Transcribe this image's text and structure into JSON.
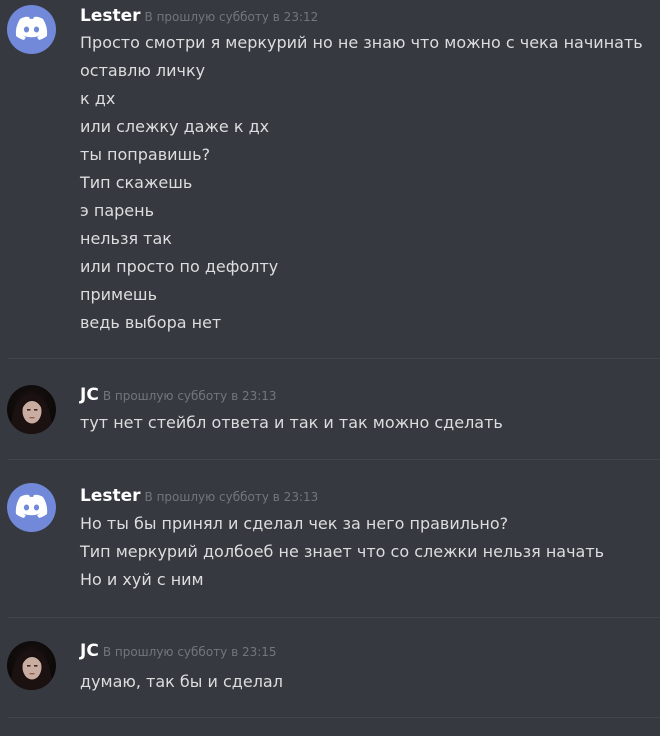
{
  "messages": [
    {
      "author": "Lester",
      "avatar": "discord-logo",
      "timestamp": "В прошлую субботу в 23:12",
      "lines": [
        "Просто смотри я меркурий но не знаю что можно с чека начинать",
        "оставлю личку",
        "к дх",
        "или слежку даже к дх",
        "ты поправишь?",
        "Тип скажешь",
        "э парень",
        "нельзя так",
        "или просто по дефолту",
        "примешь",
        "ведь выбора нет"
      ]
    },
    {
      "author": "JC",
      "avatar": "user-photo",
      "timestamp": "В прошлую субботу в 23:13",
      "lines": [
        "тут нет стейбл ответа и так и так можно сделать"
      ]
    },
    {
      "author": "Lester",
      "avatar": "discord-logo",
      "timestamp": "В прошлую субботу в 23:13",
      "lines": [
        "Но ты бы принял и сделал чек за него правильно?",
        "Тип меркурий долбоеб не знает что со слежки нельзя начать",
        "Но и хуй с ним"
      ]
    },
    {
      "author": "JC",
      "avatar": "user-photo",
      "timestamp": "В прошлую субботу в 23:15",
      "lines": [
        "думаю, так бы и сделал"
      ]
    }
  ],
  "colors": {
    "background": "#36393f",
    "author": "#ffffff",
    "timestamp": "#72767d",
    "text": "#dcddde",
    "discord_blurple": "#7289da",
    "divider": "#42454a"
  }
}
